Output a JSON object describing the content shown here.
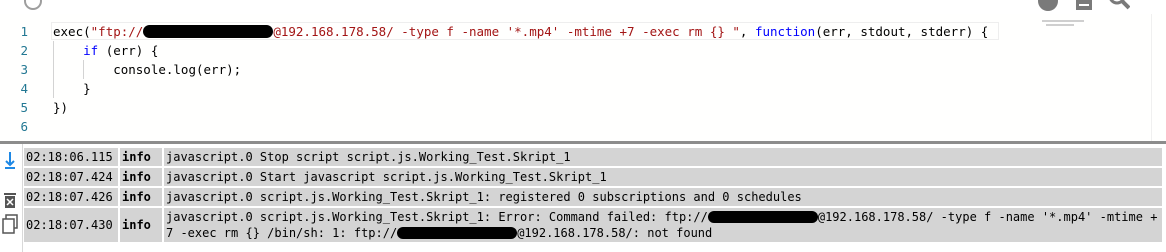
{
  "editor": {
    "line_numbers": [
      "1",
      "2",
      "3",
      "4",
      "5",
      "6"
    ],
    "lines": [
      {
        "segments": [
          {
            "cls": "plain",
            "text": "exec("
          },
          {
            "cls": "str",
            "text": "\"ftp://"
          },
          {
            "cls": "redacted",
            "width": 130
          },
          {
            "cls": "str",
            "text": "@192.168.178.58/ -type f -name '*.mp4' -mtime +7 -exec rm {} \""
          },
          {
            "cls": "plain",
            "text": ", "
          },
          {
            "cls": "kw",
            "text": "function"
          },
          {
            "cls": "plain",
            "text": "(err, stdout, stderr) {"
          }
        ]
      },
      {
        "segments": [
          {
            "cls": "plain",
            "text": "    "
          },
          {
            "cls": "kw",
            "text": "if"
          },
          {
            "cls": "plain",
            "text": " (err) {"
          }
        ]
      },
      {
        "segments": [
          {
            "cls": "plain",
            "text": "        console.log(err);"
          }
        ]
      },
      {
        "segments": [
          {
            "cls": "plain",
            "text": "    }"
          }
        ]
      },
      {
        "segments": [
          {
            "cls": "plain",
            "text": "})"
          }
        ]
      },
      {
        "segments": []
      }
    ]
  },
  "log": {
    "rows": [
      {
        "time": "02:18:06.115",
        "level": "info",
        "message": "javascript.0 Stop script script.js.Working_Test.Skript_1"
      },
      {
        "time": "02:18:07.424",
        "level": "info",
        "message": "javascript.0 Start javascript script.js.Working_Test.Skript_1"
      },
      {
        "time": "02:18:07.426",
        "level": "info",
        "message": "javascript.0 script.js.Working_Test.Skript_1: registered 0 subscriptions and 0 schedules"
      },
      {
        "time": "02:18:07.430",
        "level": "info",
        "message_parts": [
          {
            "text": "javascript.0 script.js.Working_Test.Skript_1: Error: Command failed: ftp://"
          },
          {
            "redacted": true,
            "width": 110
          },
          {
            "text": "@192.168.178.58/ -type f -name '*.mp4' -mtime +7 -exec rm {} /bin/sh: 1: ftp://"
          },
          {
            "redacted": true,
            "width": 120
          },
          {
            "text": "@192.168.178.58/: not found"
          }
        ]
      }
    ]
  },
  "colors": {
    "keyword": "#0000ff",
    "string": "#a31515",
    "line_number": "#237893",
    "log_row_bg": "#d4d4d4",
    "divider": "#8c8c8c"
  },
  "icons": {
    "toolbar": [
      "history-icon",
      "list-icon",
      "search-icon"
    ],
    "log_tools": [
      "scroll-down-icon",
      "clear-log-icon",
      "copy-icon"
    ]
  }
}
